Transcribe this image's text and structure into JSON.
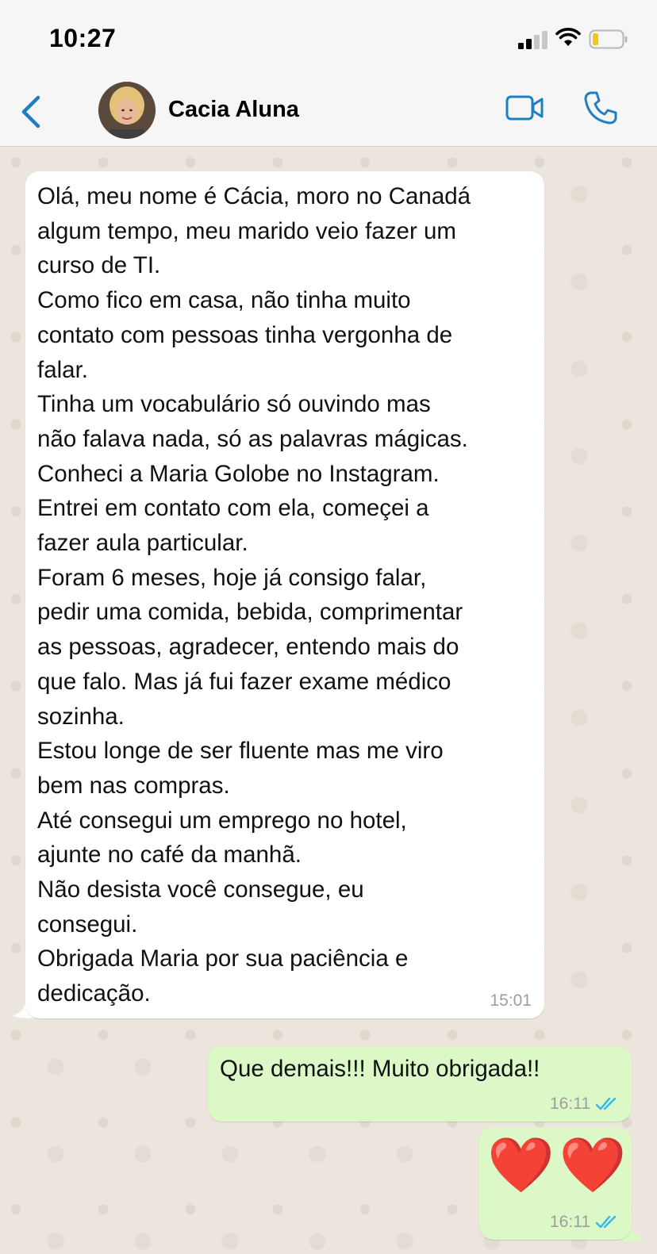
{
  "status_bar": {
    "time": "10:27"
  },
  "header": {
    "contact_name": "Cacia Aluna",
    "icons": [
      "back-chevron-icon",
      "avatar",
      "video-call-icon",
      "phone-call-icon"
    ],
    "accent_color": "#1f7fc2"
  },
  "messages": [
    {
      "direction": "incoming",
      "text": "Olá, meu nome é Cácia, moro no Canadá\nalgum tempo, meu marido veio fazer um\ncurso de TI.\nComo fico em casa, não tinha muito\ncontato com pessoas tinha vergonha de\nfalar.\nTinha um vocabulário só ouvindo mas\nnão falava nada, só as palavras mágicas.\nConheci a Maria Golobe no Instagram.\nEntrei em contato com ela, começei a\nfazer aula particular.\nForam 6 meses, hoje já consigo falar,\npedir uma comida, bebida, comprimentar\nas pessoas, agradecer, entendo mais do\nque falo. Mas já fui fazer exame médico\nsozinha.\nEstou longe de ser fluente mas me viro\nbem nas compras.\nAté consegui um emprego no hotel,\najunte no café da manhã.\nNão desista você consegue, eu\nconsegui.\nObrigada Maria por sua paciência e\ndedicação.",
      "time": "15:01"
    },
    {
      "direction": "outgoing",
      "text": "Que demais!!! Muito obrigada!!",
      "time": "16:11",
      "status": "read"
    },
    {
      "direction": "outgoing",
      "text": "❤️❤️",
      "time": "16:11",
      "status": "read"
    }
  ],
  "colors": {
    "incoming_bubble": "#ffffff",
    "outgoing_bubble": "#dcf8c6",
    "read_ticks": "#34b7f1",
    "chat_background": "#ece5dd"
  }
}
